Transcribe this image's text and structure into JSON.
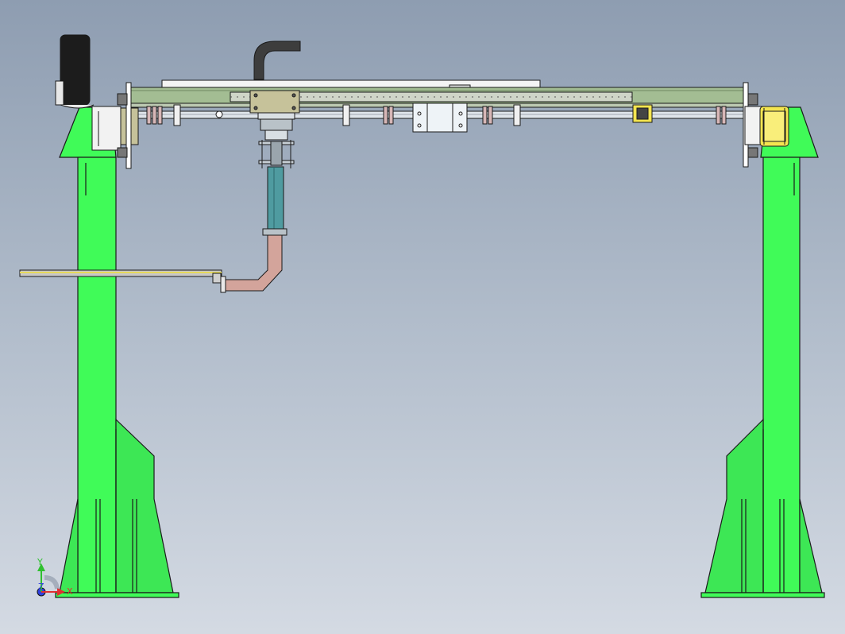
{
  "view": {
    "background_top": "#8e9db1",
    "background_bottom": "#d4dae3"
  },
  "colors": {
    "frame_green": "#40fb58",
    "beam_sage": "#a3bd93",
    "column_teal": "#4f9ba0",
    "elbow_pink": "#d3a49b",
    "motor_yellow": "#f4e550",
    "carriage_olive": "#c6c29a",
    "outline": "#1a1a1a",
    "triad_x": "#e03030",
    "triad_y": "#30c030",
    "triad_z": "#3040e0"
  },
  "triad": {
    "x_label": "X",
    "y_label": "Y",
    "z_label": "Z"
  }
}
